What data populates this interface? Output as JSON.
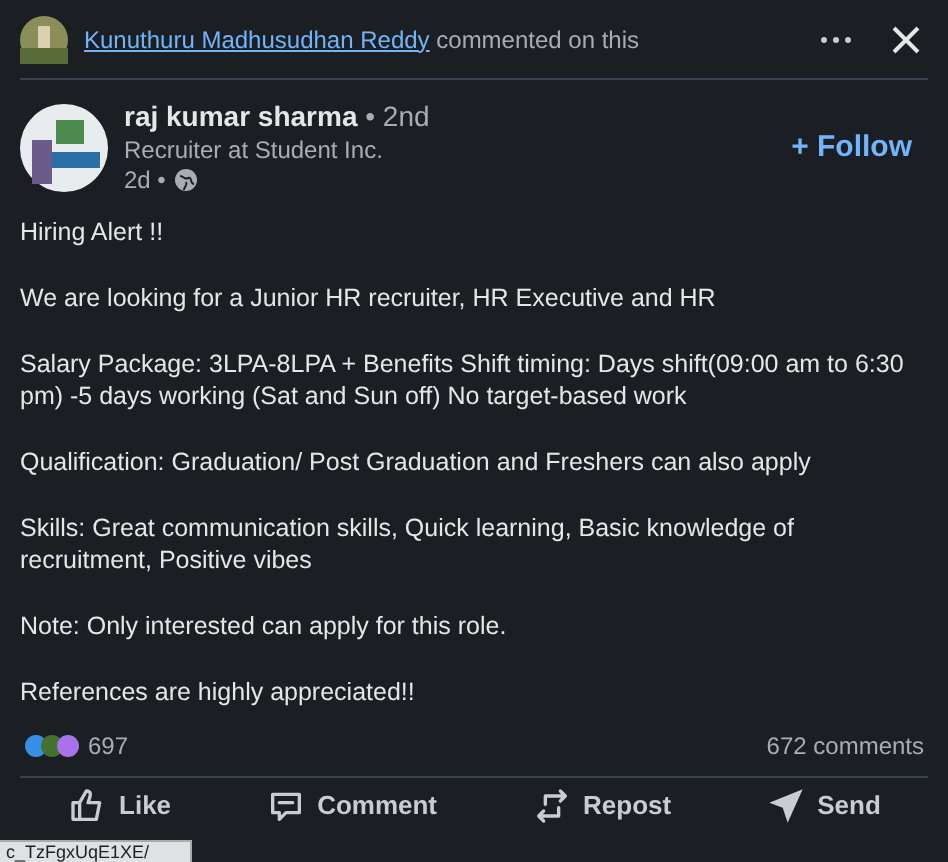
{
  "header": {
    "commenter": "Kunuthuru Madhusudhan Reddy",
    "action": "commented on this"
  },
  "author": {
    "name": "raj kumar sharma",
    "degree": "• 2nd",
    "headline": "Recruiter at Student Inc.",
    "time": "2d •"
  },
  "follow_button": "+ Follow",
  "post": {
    "paragraphs": [
      "Hiring Alert !!",
      "We are looking for a Junior HR recruiter, HR Executive and HR",
      "Salary Package: 3LPA-8LPA + Benefits Shift timing: Days shift(09:00 am to 6:30 pm) -5 days working (Sat and Sun off) No target-based work",
      "Qualification: Graduation/ Post Graduation and Freshers can also apply",
      "Skills: Great communication skills, Quick learning, Basic knowledge of recruitment, Positive vibes",
      "Note: Only interested can apply for this role.",
      "References are highly appreciated!!"
    ]
  },
  "social": {
    "reactions": "697",
    "comments": "672 comments"
  },
  "actions": [
    {
      "kind": "like",
      "label": "Like"
    },
    {
      "kind": "comment",
      "label": "Comment"
    },
    {
      "kind": "repost",
      "label": "Repost"
    },
    {
      "kind": "send",
      "label": "Send"
    }
  ],
  "status_url": "c_TzFgxUqE1XE/"
}
